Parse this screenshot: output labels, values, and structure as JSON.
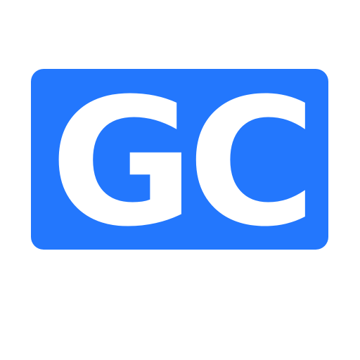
{
  "logo": {
    "text": "GC",
    "colors": {
      "background": "#ffffff",
      "badge": "#2377fd",
      "text": "#ffffff"
    }
  }
}
